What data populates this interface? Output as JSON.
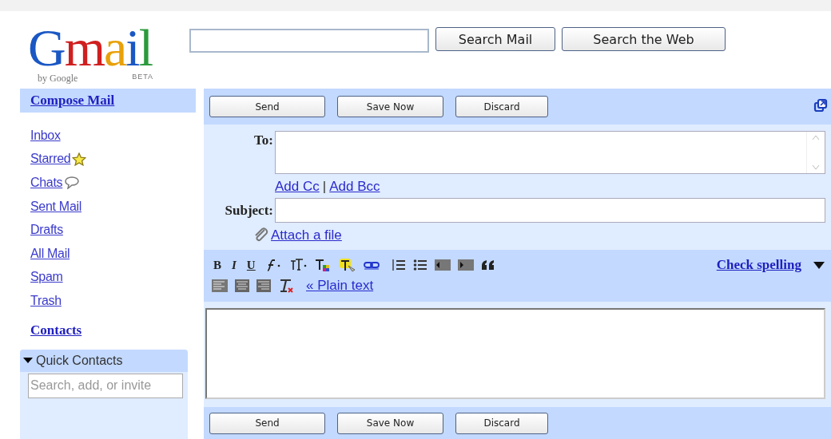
{
  "logo": {
    "letters": "Gmail",
    "byline": "by Google",
    "badge": "BETA"
  },
  "search": {
    "buttons": [
      "Search Mail",
      "Search the Web"
    ]
  },
  "sidebar": {
    "compose": "Compose Mail",
    "items": [
      {
        "label": "Inbox",
        "kind": "plain"
      },
      {
        "label": "Starred",
        "kind": "star"
      },
      {
        "label": "Chats",
        "kind": "chat"
      },
      {
        "label": "Sent Mail",
        "kind": "plain"
      },
      {
        "label": "Drafts",
        "kind": "plain"
      },
      {
        "label": "All Mail",
        "kind": "plain"
      },
      {
        "label": "Spam",
        "kind": "plain"
      },
      {
        "label": "Trash",
        "kind": "plain"
      }
    ],
    "contacts": "Contacts",
    "quick_contacts": {
      "title": "Quick Contacts",
      "expanded": true,
      "placeholder": "Search, add, or invite"
    }
  },
  "compose": {
    "top_buttons": [
      "Send",
      "Save Now",
      "Discard"
    ],
    "to_label": "To:",
    "add_cc": "Add Cc",
    "separator": "|",
    "add_bcc": "Add Bcc",
    "subject_label": "Subject:",
    "attach": "Attach a file",
    "format_letters": [
      "B",
      "I",
      "U"
    ],
    "check_spelling": "Check spelling",
    "plain_text": "« Plain text",
    "bottom_buttons": [
      "Send",
      "Save Now",
      "Discard"
    ]
  }
}
